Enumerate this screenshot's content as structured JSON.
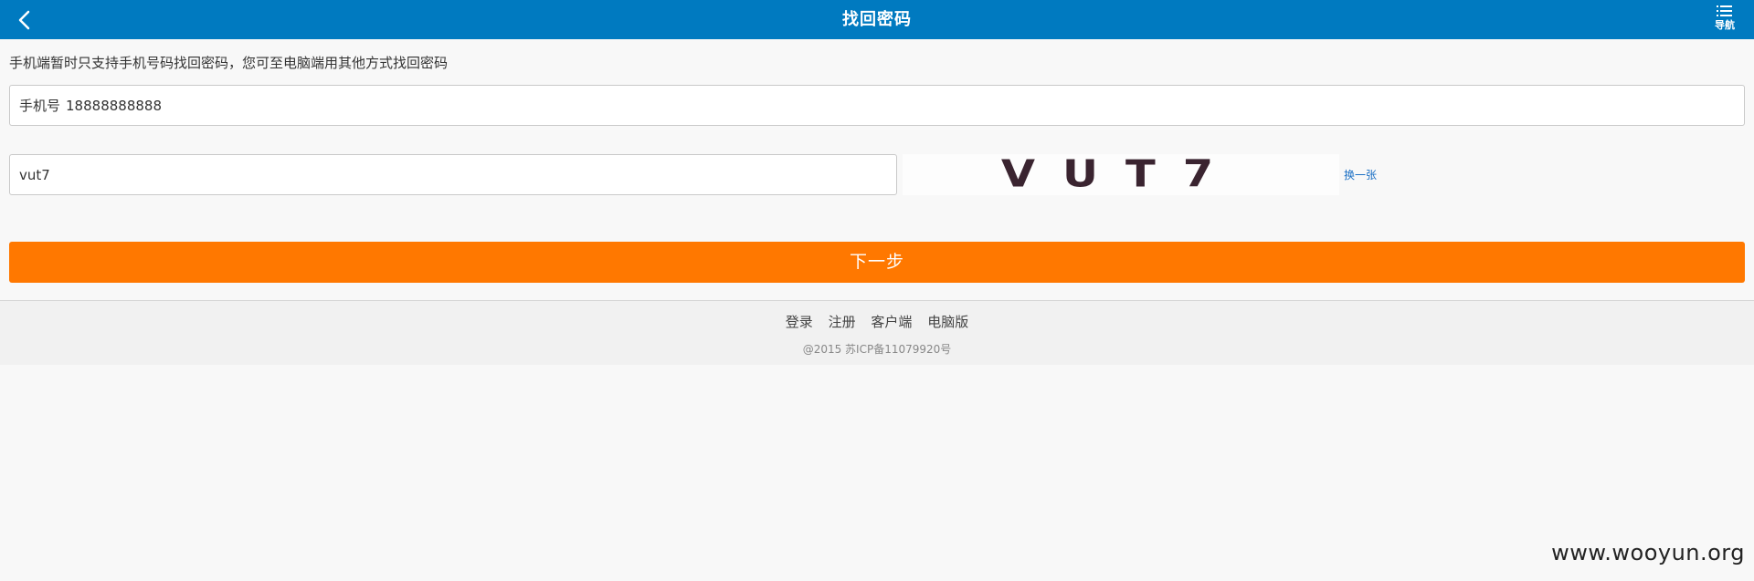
{
  "header": {
    "title": "找回密码",
    "nav_label": "导航",
    "back_icon": "chevron-left-icon",
    "nav_icon": "list-icon",
    "background": "#007ac0"
  },
  "notice": "手机端暂时只支持手机号码找回密码，您可至电脑端用其他方式找回密码",
  "phone": {
    "label": "手机号",
    "value": "18888888888"
  },
  "captcha": {
    "value": "vut7",
    "image_text": "VUT7",
    "refresh_label": "换一张"
  },
  "next_button": {
    "label": "下一步",
    "color": "#ff7800"
  },
  "footer": {
    "links": [
      "登录",
      "注册",
      "客户端",
      "电脑版"
    ],
    "copyright": "@2015 苏ICP备11079920号"
  },
  "watermark": "www.wooyun.org"
}
